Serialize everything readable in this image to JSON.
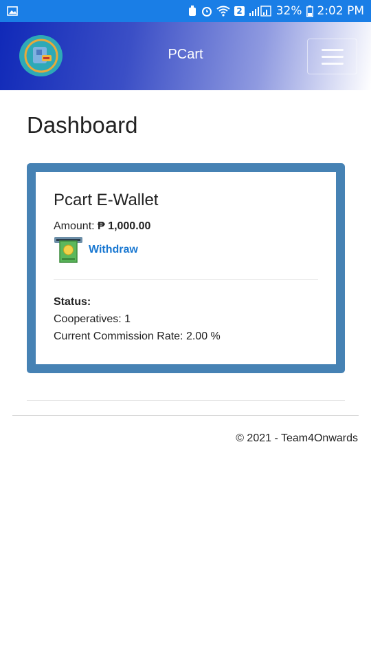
{
  "status_bar": {
    "battery_percent": "32%",
    "time": "2:02 PM",
    "sim_badge": "2",
    "icons": [
      "image-icon",
      "alarm-clock-icon",
      "wifi-icon",
      "signal-icon",
      "battery-icon"
    ]
  },
  "navbar": {
    "title": "PCart",
    "logo_icon": "pcart-logo-icon",
    "menu_icon": "hamburger-menu-icon"
  },
  "page": {
    "title": "Dashboard"
  },
  "wallet": {
    "title": "Pcart E-Wallet",
    "amount_label": "Amount:",
    "amount_value": "₱ 1,000.00",
    "withdraw_label": "Withdraw",
    "withdraw_icon": "atm-cash-icon",
    "status_label": "Status:",
    "cooperatives_line": "Cooperatives: 1",
    "commission_line": "Current Commission Rate: 2.00 %"
  },
  "footer": {
    "text": "© 2021 - Team4Onwards"
  },
  "colors": {
    "status_bar": "#1a7ee6",
    "card_border": "#4682b4",
    "link": "#1877d1",
    "logo": "#2ea9b7"
  }
}
